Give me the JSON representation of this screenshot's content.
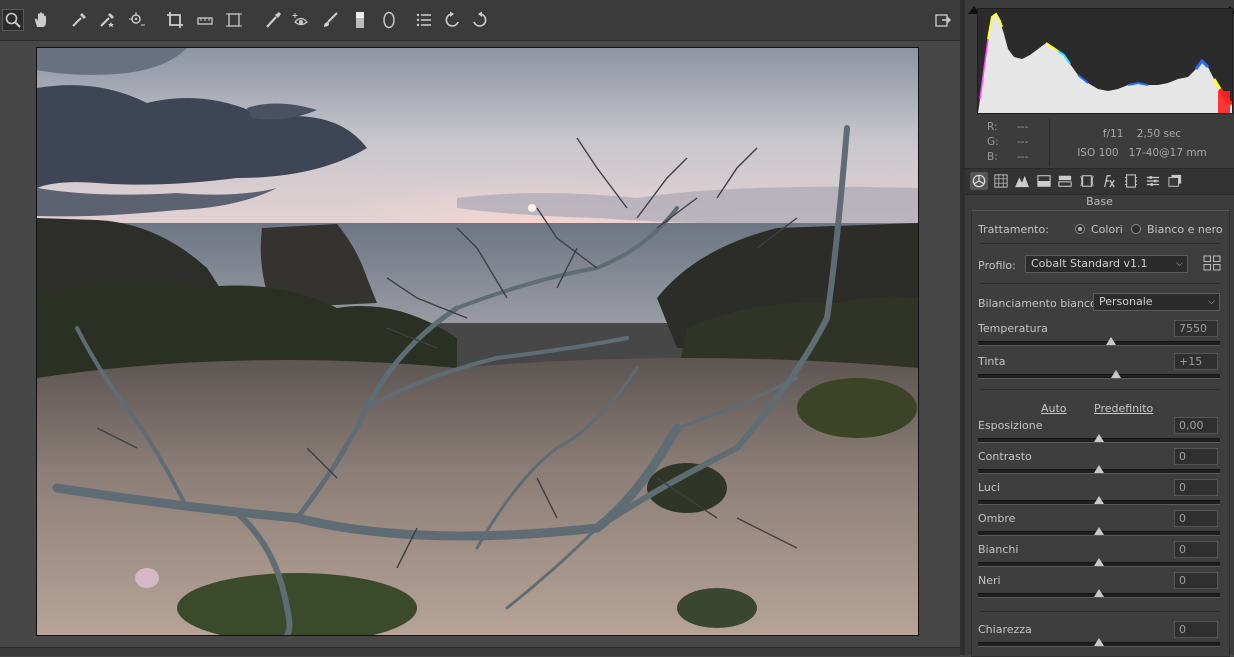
{
  "toolbar": {
    "tools": [
      "zoom-icon",
      "hand-icon",
      "white-balance-icon",
      "color-sampler-icon",
      "targeted-adjustment-icon",
      "crop-icon",
      "straighten-icon",
      "transform-icon",
      "spot-removal-icon",
      "red-eye-icon",
      "adjustment-brush-icon",
      "graduated-filter-icon",
      "radial-filter-icon",
      "presets-list-icon",
      "rotate-left-icon",
      "rotate-right-icon"
    ],
    "open_preferences_icon": "preferences-icon"
  },
  "histogram": {
    "colors": {
      "background": "#2b2b2b",
      "luma": "#e8e8e8",
      "red": "#ff2020",
      "yellow": "#ffff30",
      "blue": "#2a6aff",
      "cyan": "#30e8ff",
      "magenta": "#ff40ff"
    }
  },
  "info": {
    "r_label": "R:",
    "g_label": "G:",
    "b_label": "B:",
    "r_value": "---",
    "g_value": "---",
    "b_value": "---",
    "aperture": "f/11",
    "shutter": "2,50 sec",
    "iso": "ISO 100",
    "lens": "17-40@17 mm"
  },
  "tabs": [
    "base-icon",
    "tone-curve-icon",
    "detail-icon",
    "hsl-icon",
    "split-toning-icon",
    "lens-corrections-icon",
    "effects-icon",
    "camera-calibration-icon",
    "presets-icon",
    "snapshots-icon"
  ],
  "section": {
    "title": "Base"
  },
  "treatment": {
    "label": "Trattamento:",
    "option_color": "Colori",
    "option_bw": "Bianco e nero"
  },
  "profile": {
    "label": "Profilo:",
    "value": "Cobalt Standard v1.1"
  },
  "wb": {
    "label": "Bilanciamento bianco:",
    "value": "Personale"
  },
  "sliders_wb": [
    {
      "label": "Temperatura",
      "value": "7550",
      "position": 0.55
    },
    {
      "label": "Tinta",
      "value": "+15",
      "position": 0.57
    }
  ],
  "auto_label": "Auto",
  "default_label": "Predefinito",
  "sliders_tone": [
    {
      "label": "Esposizione",
      "value": "0,00",
      "position": 0.5
    },
    {
      "label": "Contrasto",
      "value": "0",
      "position": 0.5
    },
    {
      "label": "Luci",
      "value": "0",
      "position": 0.5
    },
    {
      "label": "Ombre",
      "value": "0",
      "position": 0.5
    },
    {
      "label": "Bianchi",
      "value": "0",
      "position": 0.5
    },
    {
      "label": "Neri",
      "value": "0",
      "position": 0.5
    }
  ],
  "sliders_presence": [
    {
      "label": "Chiarezza",
      "value": "0",
      "position": 0.5
    }
  ]
}
